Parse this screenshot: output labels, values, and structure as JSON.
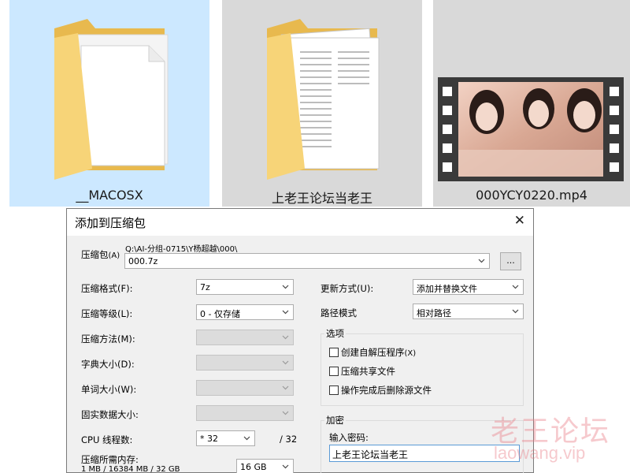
{
  "explorer": {
    "items": [
      {
        "label": "__MACOSX",
        "icon": "folder-icon",
        "selected": true
      },
      {
        "label": "上老王论坛当老王",
        "icon": "folder-with-documents-icon",
        "selected": false
      },
      {
        "label": "000YCY0220.mp4",
        "icon": "video-thumbnail-icon",
        "selected": false
      }
    ]
  },
  "dialog": {
    "title": "添加到压缩包",
    "archive": {
      "label": "压缩包",
      "label_key": "(A)",
      "path": "Q:\\AI-分组-0715\\Y杨超越\\000\\",
      "name": "000.7z",
      "browse_label": "..."
    },
    "left": {
      "format": {
        "label": "压缩格式",
        "key": "(F):",
        "value": "7z"
      },
      "level": {
        "label": "压缩等级",
        "key": "(L):",
        "value": "0 - 仅存储"
      },
      "method": {
        "label": "压缩方法",
        "key": "(M):",
        "value": ""
      },
      "dict": {
        "label": "字典大小",
        "key": "(D):",
        "value": ""
      },
      "word": {
        "label": "单词大小",
        "key": "(W):",
        "value": ""
      },
      "solid": {
        "label": "固实数据大小:",
        "value": ""
      },
      "threads": {
        "label": "CPU 线程数:",
        "value": "* 32",
        "total": "/ 32"
      },
      "memory": {
        "label": "压缩所需内存:",
        "detail": "1 MB / 16384 MB / 32 GB",
        "value": "16 GB"
      }
    },
    "right": {
      "update": {
        "label": "更新方式",
        "key": "(U):",
        "value": "添加并替换文件"
      },
      "pathmode": {
        "label": "路径模式",
        "value": "相对路径"
      },
      "options": {
        "title": "选项",
        "items": [
          {
            "label": "创建自解压程序",
            "key": "(X)",
            "checked": false
          },
          {
            "label": "压缩共享文件",
            "key": "",
            "checked": false
          },
          {
            "label": "操作完成后删除源文件",
            "key": "",
            "checked": false
          }
        ]
      },
      "encryption": {
        "title": "加密",
        "password_label": "输入密码:",
        "password_value": "上老王论坛当老王"
      }
    }
  },
  "watermark": {
    "cn": "老王论坛",
    "en": "laowang.vip"
  },
  "colors": {
    "selection": "#cce8ff",
    "tile_gray": "#d9d9d9",
    "dialog_bg": "#f0f0f0",
    "folder": "#f7d478",
    "watermark": "#e87882"
  }
}
